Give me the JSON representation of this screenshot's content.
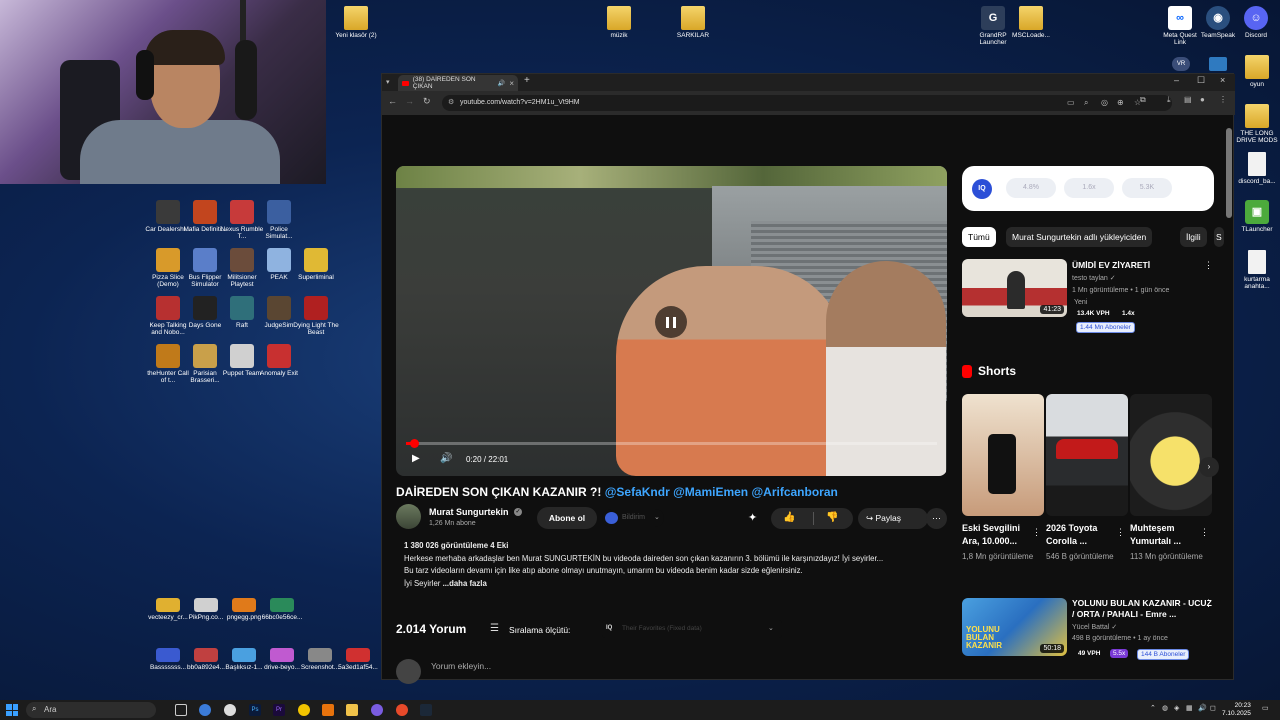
{
  "desktop": {
    "top_icons": [
      {
        "label": "Yeni klasör (2)",
        "type": "folder"
      },
      {
        "label": "müzik",
        "type": "folder"
      },
      {
        "label": "SARKILAR",
        "type": "folder"
      },
      {
        "label": "GrandRP Launcher",
        "type": "app"
      },
      {
        "label": "MSCLoade...",
        "type": "folder"
      },
      {
        "label": "Meta Quest Link",
        "type": "app"
      },
      {
        "label": "TeamSpeak",
        "type": "app"
      },
      {
        "label": "Discord",
        "type": "app"
      }
    ],
    "right_icons": [
      {
        "label": "oyun",
        "type": "folder"
      },
      {
        "label": "THE LONG DRIVE MODS",
        "type": "folder"
      },
      {
        "label": "discord_ba...",
        "type": "file"
      },
      {
        "label": "TLauncher",
        "type": "app"
      },
      {
        "label": "kurtarma anahta...",
        "type": "file"
      }
    ],
    "vr_badge": "VR",
    "game_icons": [
      {
        "label": "Car Dealershi...",
        "color": "#3a3a3a"
      },
      {
        "label": "Mafia Definiti...",
        "color": "#c2451e"
      },
      {
        "label": "Nexus Rumble T...",
        "color": "#c73a3a"
      },
      {
        "label": "Police Simulat...",
        "color": "#3b5fa0"
      },
      {
        "label": "Pizza Slice (Demo)",
        "color": "#d89a2a"
      },
      {
        "label": "Bus Flipper Simulator",
        "color": "#5a7ec9"
      },
      {
        "label": "Militsioner Playtest",
        "color": "#6b4c3b"
      },
      {
        "label": "PEAK",
        "color": "#8fb3e0"
      },
      {
        "label": "Superliminal",
        "color": "#e0b934"
      },
      {
        "label": "Keep Talking and Nobo...",
        "color": "#b73030"
      },
      {
        "label": "Days Gone",
        "color": "#222222"
      },
      {
        "label": "Raft",
        "color": "#2f6f7a"
      },
      {
        "label": "JudgeSim",
        "color": "#5a4632"
      },
      {
        "label": "Dying Light The Beast",
        "color": "#b02020"
      },
      {
        "label": "theHunter Call of t...",
        "color": "#c07a1a"
      },
      {
        "label": "Parisian Brasseri...",
        "color": "#c9a04a"
      },
      {
        "label": "Puppet Team",
        "color": "#d0d0d0"
      },
      {
        "label": "Anomaly Exit",
        "color": "#c83030"
      }
    ],
    "file_icons_row1": [
      "vecteezy_cr...",
      "PikPng.co...",
      "pngegg.png",
      "66bc0e56ce..."
    ],
    "file_icons_row2": [
      "Basssssss...",
      "bb0a892e4...",
      "Başlıksız-1...",
      "drive-beyo...",
      "Screenshot...",
      "5a3ed1af54..."
    ]
  },
  "browser": {
    "tab_title": "(38) DAİREDEN SON ÇIKAN",
    "url": "youtube.com/watch?v=2HM1u_Vt9HM"
  },
  "video": {
    "time": "0:20 / 22:01",
    "progress_fraction": 0.015,
    "title_main": "DAİREDEN SON ÇIKAN KAZANIR ?!",
    "title_tags": "@SefaKndr @MamiEmen @Arifcanboran",
    "channel": "Murat Sungurtekin",
    "subs": "1,26 Mn abone",
    "subscribe": "Abone ol",
    "notify_text": "Bildirim",
    "share": "Paylaş",
    "views_line": "1 380 026 görüntüleme  4 Eki",
    "desc_line1": "Herkese merhaba arkadaşlar ben Murat SUNGURTEKİN bu videoda daireden son çıkan kazanırın 3. bölümü ile karşınızdayız! İyi seyirler...",
    "desc_line2": "Bu tarz videoların devamı için like atıp abone olmayı unutmayın, umarım bu videoda benim kadar sizde eğlenirsiniz.",
    "desc_line3": "İyi Seyirler",
    "more": "...daha fazla",
    "comments_count": "2.014 Yorum",
    "sort_label": "Sıralama ölçütü:",
    "sort_iq": "IQ",
    "sort_value": "Their Favorites (Fixed data)",
    "add_comment": "Yorum ekleyin..."
  },
  "sidebar": {
    "iq_logo": "IQ",
    "iq_metrics": [
      "4.8%",
      "1.6x",
      "5.3K"
    ],
    "chips": [
      "Tümü",
      "Murat Sungurtekin adlı yükleyiciden",
      "İlgili",
      "S"
    ],
    "rec1": {
      "title": "ÜMİDİ EV ZİYARETİ",
      "channel": "testo taylan",
      "meta": "1 Mn görüntüleme • 1 gün önce",
      "badge": "Yeni",
      "vph": "13.4K VPH",
      "mult": "1.4x",
      "subs_pill": "1.44 Mn Aboneler",
      "duration": "41:23"
    },
    "shorts_title": "Shorts",
    "shorts": [
      {
        "title": "Eski Sevgilini Ara, 10.000...",
        "views": "1,8 Mn görüntüleme"
      },
      {
        "title": "2026 Toyota Corolla ...",
        "views": "546 B görüntüleme"
      },
      {
        "title": "Muhteşem Yumurtalı ...",
        "views": "113 Mn görüntüleme"
      }
    ],
    "rec2": {
      "title": "YOLUNU BULAN KAZANIR - UCUZ / ORTA / PAHALI - Emre ...",
      "channel": "Yücel Battal",
      "meta": "498 B görüntüleme • 1 ay önce",
      "vph": "49 VPH",
      "mult": "5.5x",
      "subs_pill": "144 B Aboneler",
      "duration": "50:18",
      "thumb_text": "YOLUNU BULAN KAZANIR"
    }
  },
  "taskbar": {
    "search": "Ara",
    "time": "20:23",
    "date": "7.10.2025"
  },
  "colors": {
    "youtube_red": "#ff0000",
    "link_blue": "#3ea6ff",
    "desktop_blue": "#0c2452"
  }
}
